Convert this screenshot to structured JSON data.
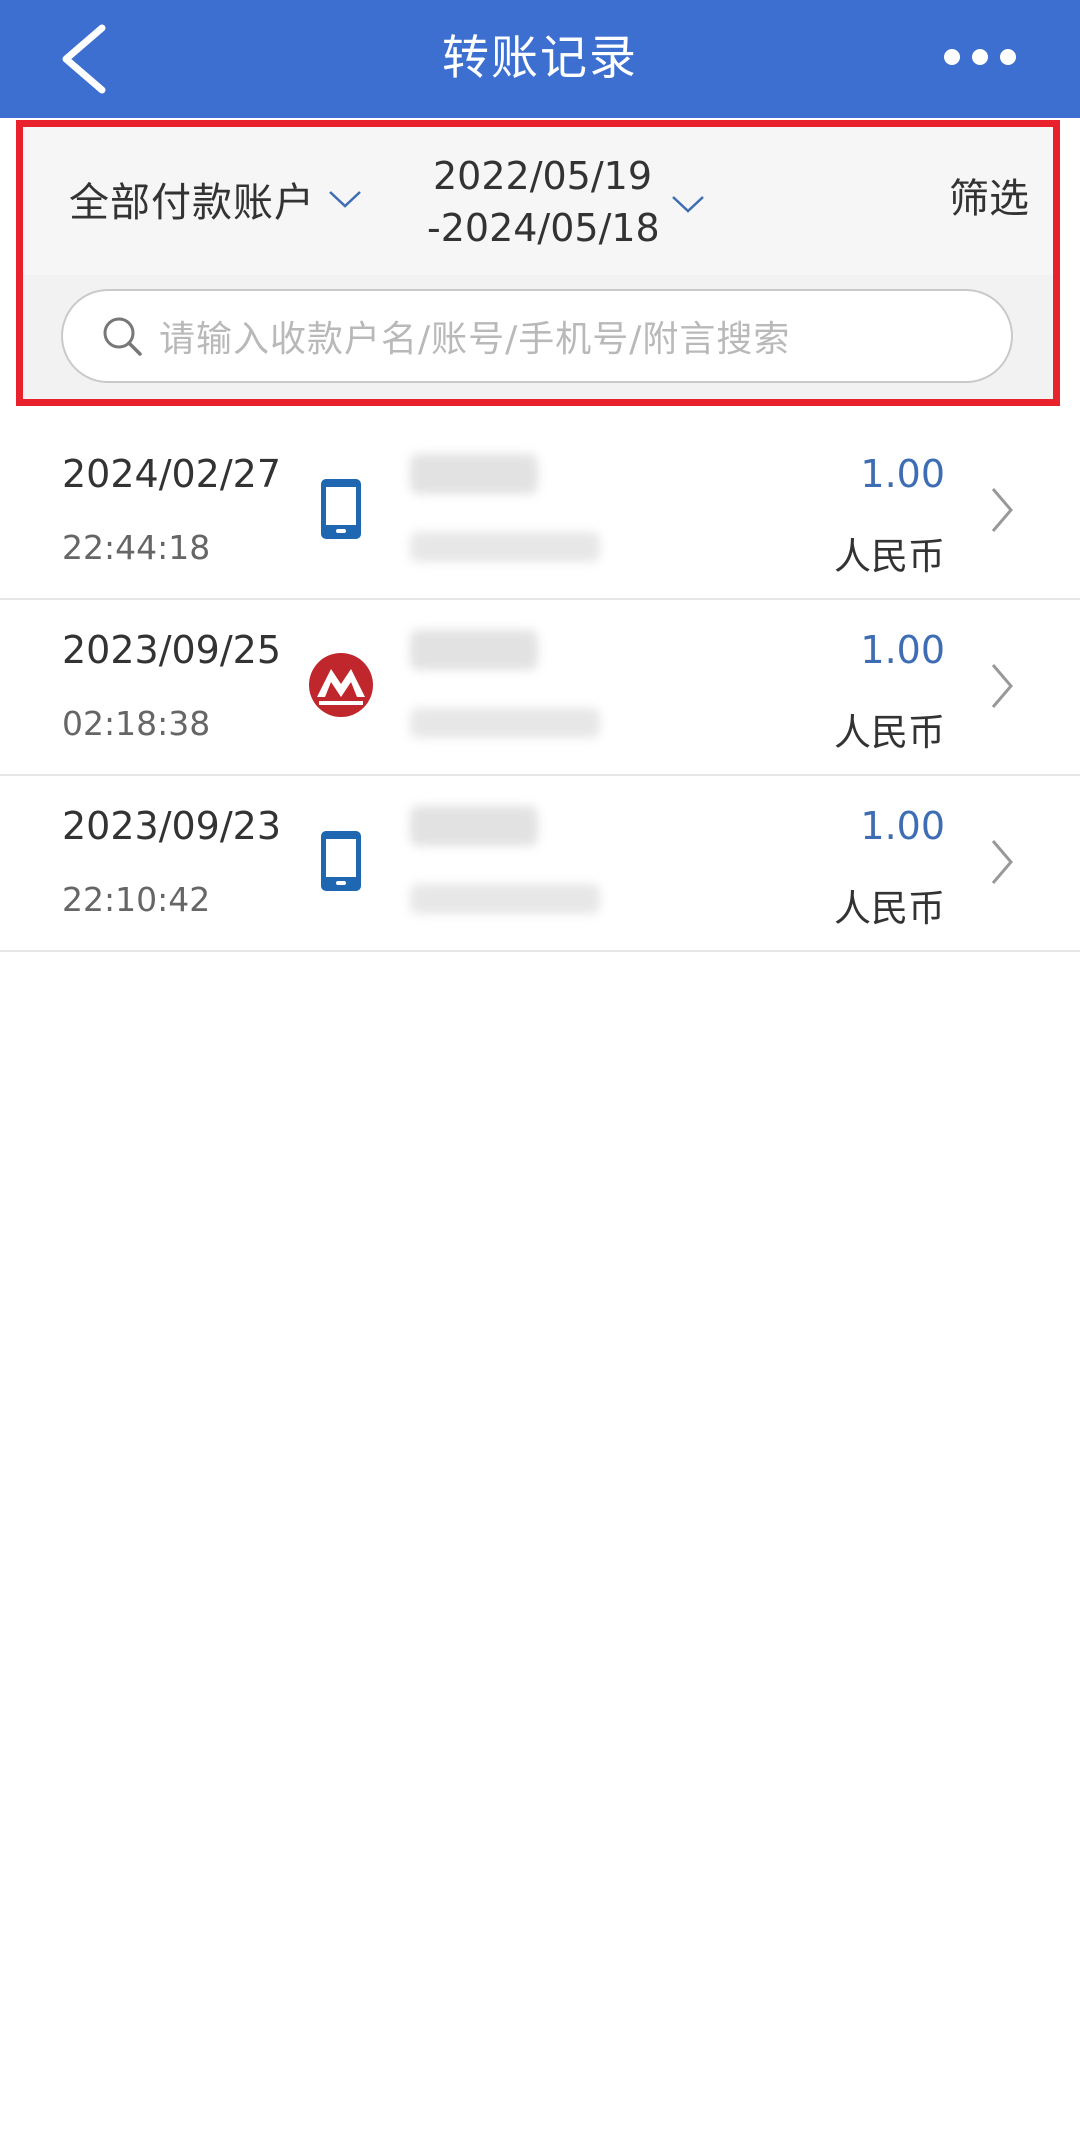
{
  "header": {
    "title": "转账记录",
    "back_icon": "chevron-left-icon",
    "more_icon": "more-horizontal-icon",
    "background_color": "#3d6fd1"
  },
  "filters": {
    "account_label": "全部付款账户",
    "date_start": "2022/05/19",
    "date_end": "-2024/05/18",
    "filter_label": "筛选",
    "highlight_color": "#e8212c"
  },
  "search": {
    "placeholder": "请输入收款户名/账号/手机号/附言搜索"
  },
  "transactions": [
    {
      "date": "2024/02/27",
      "time": "22:44:18",
      "channel_icon": "mobile-phone-icon",
      "amount": "1.00",
      "currency": "人民币"
    },
    {
      "date": "2023/09/25",
      "time": "02:18:38",
      "channel_icon": "bank-logo-icon",
      "amount": "1.00",
      "currency": "人民币"
    },
    {
      "date": "2023/09/23",
      "time": "22:10:42",
      "channel_icon": "mobile-phone-icon",
      "amount": "1.00",
      "currency": "人民币"
    }
  ],
  "colors": {
    "amount": "#3f6db3",
    "phone_icon": "#1f67b0",
    "bank_logo": "#c0272d"
  }
}
